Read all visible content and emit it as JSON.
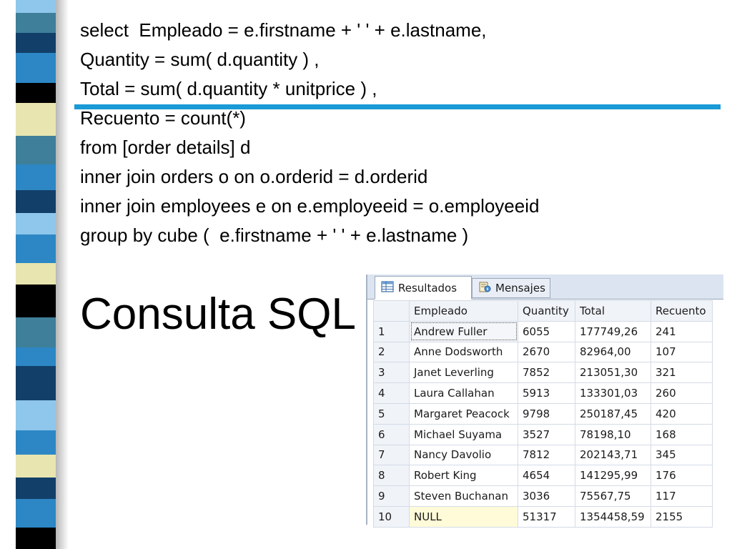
{
  "code_lines": [
    "select  Empleado = e.firstname + ' ' + e.lastname,",
    "Quantity = sum( d.quantity ) ,",
    "Total = sum( d.quantity * unitprice ) ,",
    "Recuento = count(*)",
    "from [order details] d",
    "inner join orders o on o.orderid = d.orderid",
    "inner join employees e on e.employeeid = o.employeeid",
    "group by cube (  e.firstname + ' ' + e.lastname )"
  ],
  "title": "Consulta SQL",
  "results": {
    "tabs": [
      {
        "label": "Resultados",
        "icon": "grid-icon"
      },
      {
        "label": "Mensajes",
        "icon": "messages-icon"
      }
    ],
    "columns": [
      "Empleado",
      "Quantity",
      "Total",
      "Recuento"
    ],
    "rows": [
      {
        "n": "1",
        "empleado": "Andrew Fuller",
        "quantity": "6055",
        "total": "177749,26",
        "recuento": "241"
      },
      {
        "n": "2",
        "empleado": "Anne Dodsworth",
        "quantity": "2670",
        "total": "82964,00",
        "recuento": "107"
      },
      {
        "n": "3",
        "empleado": "Janet Leverling",
        "quantity": "7852",
        "total": "213051,30",
        "recuento": "321"
      },
      {
        "n": "4",
        "empleado": "Laura Callahan",
        "quantity": "5913",
        "total": "133301,03",
        "recuento": "260"
      },
      {
        "n": "5",
        "empleado": "Margaret Peacock",
        "quantity": "9798",
        "total": "250187,45",
        "recuento": "420"
      },
      {
        "n": "6",
        "empleado": "Michael Suyama",
        "quantity": "3527",
        "total": "78198,10",
        "recuento": "168"
      },
      {
        "n": "7",
        "empleado": "Nancy Davolio",
        "quantity": "7812",
        "total": "202143,71",
        "recuento": "345"
      },
      {
        "n": "8",
        "empleado": "Robert King",
        "quantity": "4654",
        "total": "141295,99",
        "recuento": "176"
      },
      {
        "n": "9",
        "empleado": "Steven Buchanan",
        "quantity": "3036",
        "total": "75567,75",
        "recuento": "117"
      },
      {
        "n": "10",
        "empleado": "NULL",
        "quantity": "51317",
        "total": "1354458,59",
        "recuento": "2155"
      }
    ]
  },
  "colors": {
    "accent_line": "#1a9ad6",
    "stripe_navy": "#123f69",
    "stripe_blue": "#2d87c5",
    "stripe_sky": "#8fc7ec",
    "stripe_cream": "#e8e5b0",
    "stripe_black": "#000000",
    "stripe_teal": "#3f7f9a"
  }
}
